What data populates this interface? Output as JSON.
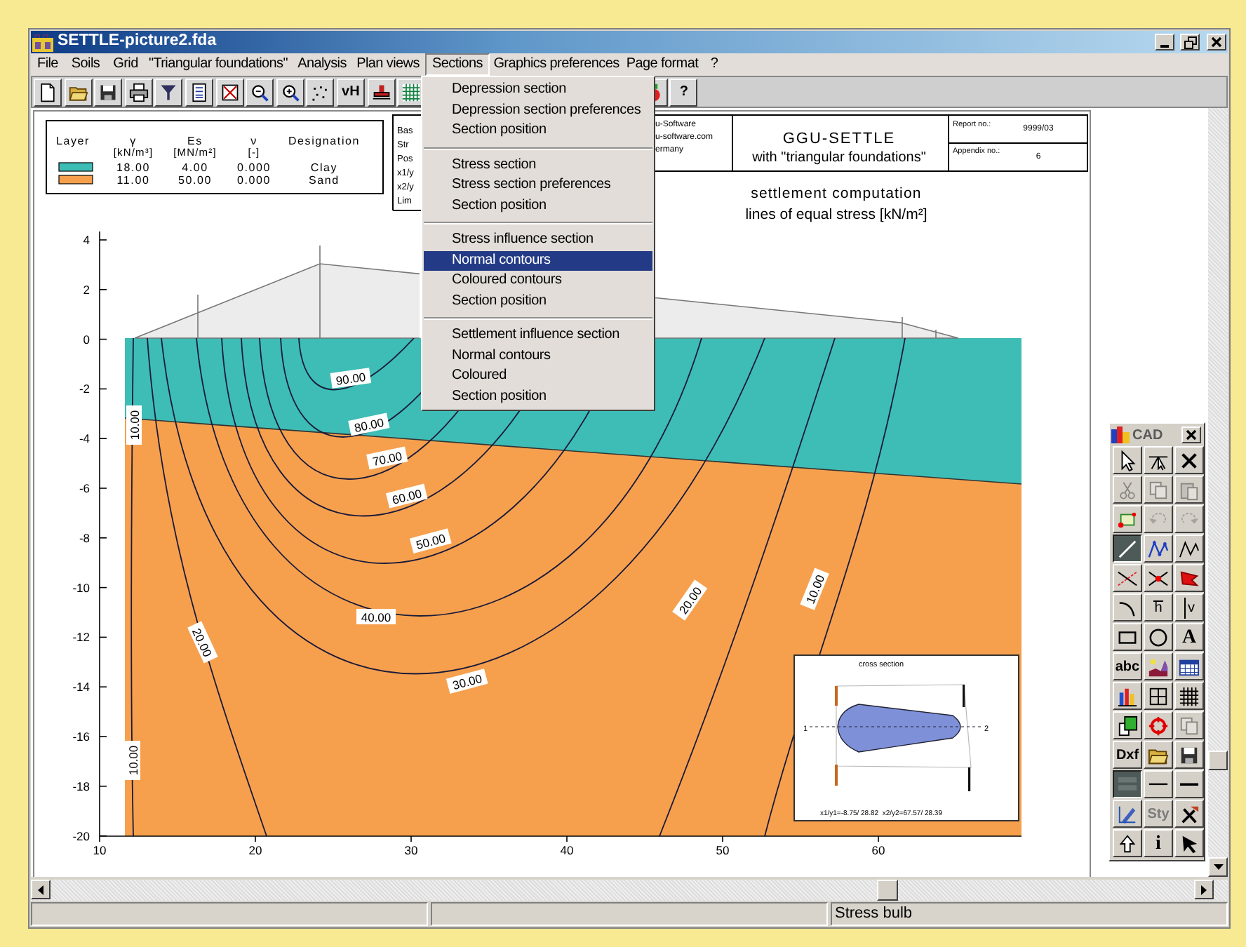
{
  "window": {
    "title": "SETTLE-picture2.fda"
  },
  "menu_bar": [
    {
      "label": "File",
      "selected": false
    },
    {
      "label": "Soils",
      "selected": false
    },
    {
      "label": "Grid",
      "selected": false
    },
    {
      "label": "\"Triangular foundations\"",
      "selected": false
    },
    {
      "label": "Analysis",
      "selected": false
    },
    {
      "label": "Plan views",
      "selected": false
    },
    {
      "label": "Sections",
      "selected": true
    },
    {
      "label": "Graphics preferences",
      "selected": false
    },
    {
      "label": "Page format",
      "selected": false
    },
    {
      "label": "?",
      "selected": false
    }
  ],
  "toolbar": [
    {
      "label": "vH"
    },
    {
      "label": "?"
    }
  ],
  "sections_menu": {
    "items": [
      {
        "kind": "item",
        "label": "Depression section",
        "selected": false
      },
      {
        "kind": "item",
        "label": "Depression section preferences",
        "selected": false
      },
      {
        "kind": "item",
        "label": "Section position",
        "selected": false
      },
      {
        "kind": "separator"
      },
      {
        "kind": "item",
        "label": "Stress section",
        "selected": false
      },
      {
        "kind": "item",
        "label": "Stress section preferences",
        "selected": false
      },
      {
        "kind": "item",
        "label": "Section position",
        "selected": false
      },
      {
        "kind": "separator"
      },
      {
        "kind": "item",
        "label": "Stress influence section",
        "selected": false
      },
      {
        "kind": "item",
        "label": "Normal contours",
        "selected": true
      },
      {
        "kind": "item",
        "label": "Coloured contours",
        "selected": false
      },
      {
        "kind": "item",
        "label": "Section position",
        "selected": false
      },
      {
        "kind": "separator"
      },
      {
        "kind": "item",
        "label": "Settlement influence section",
        "selected": false
      },
      {
        "kind": "item",
        "label": "Normal contours",
        "selected": false
      },
      {
        "kind": "item",
        "label": "Coloured",
        "selected": false
      },
      {
        "kind": "item",
        "label": "Section position",
        "selected": false
      }
    ]
  },
  "legend": {
    "columns": [
      {
        "symbol": "Layer"
      },
      {
        "symbol": "γ",
        "unit": "[kN/m³]"
      },
      {
        "symbol": "Es",
        "unit": "[MN/m²]"
      },
      {
        "symbol": "ν",
        "unit": "[-]"
      },
      {
        "symbol": "Designation"
      }
    ],
    "rows": [
      {
        "color": "#3dbdb5",
        "gamma": "18.00",
        "es": "4.00",
        "nu": "0.000",
        "designation": "Clay"
      },
      {
        "color": "#f6a04e",
        "gamma": "11.00",
        "es": "50.00",
        "nu": "0.000",
        "designation": "Sand"
      }
    ]
  },
  "header": {
    "cut_lines": [
      "Bas",
      "Str",
      "Pos",
      "x1/y",
      "x2/y",
      "Lim"
    ],
    "company_lines": [
      "u-Software",
      "u-software.com",
      "ermany"
    ],
    "program": "GGU-SETTLE",
    "subtitle": "with \"triangular foundations\"",
    "report_label": "Report no.:",
    "report_no": "9999/03",
    "appendix_label": "Appendix no.:",
    "appendix_no": "6"
  },
  "plot": {
    "title_lines": [
      "settlement computation",
      "lines of equal stress [kN/m²]"
    ],
    "y_ticks": [
      "4",
      "2",
      "0",
      "-2",
      "-4",
      "-6",
      "-8",
      "-10",
      "-12",
      "-14",
      "-16",
      "-18",
      "-20"
    ],
    "x_ticks": [
      "10",
      "20",
      "30",
      "40",
      "50",
      "60"
    ],
    "contour_labels": [
      "90.00",
      "80.00",
      "70.00",
      "60.00",
      "50.00",
      "40.00",
      "30.00",
      "20.00",
      "10.00",
      "10.00",
      "20.00",
      "10.00"
    ]
  },
  "inset": {
    "title": "cross section",
    "point_labels": [
      "1",
      "2"
    ],
    "footer": "x1/y1=-8.75/ 28.82  x2/y2=67.57/ 28.39"
  },
  "cad_palette": {
    "title": "CAD",
    "tools": [
      {
        "disabled": false,
        "pressed": false
      },
      {
        "disabled": false,
        "pressed": false
      },
      {
        "disabled": false,
        "pressed": false
      },
      {
        "disabled": true,
        "pressed": false
      },
      {
        "disabled": true,
        "pressed": false
      },
      {
        "disabled": true,
        "pressed": false
      },
      {
        "disabled": false,
        "pressed": false
      },
      {
        "disabled": true,
        "pressed": false
      },
      {
        "disabled": true,
        "pressed": false
      },
      {
        "disabled": false,
        "pressed": true
      },
      {
        "disabled": false,
        "pressed": false
      },
      {
        "disabled": false,
        "pressed": false
      },
      {
        "disabled": false,
        "pressed": false
      },
      {
        "disabled": false,
        "pressed": false
      },
      {
        "disabled": false,
        "pressed": false
      },
      {
        "disabled": false,
        "pressed": false
      },
      {
        "label": "h",
        "disabled": false,
        "pressed": false
      },
      {
        "label": "v",
        "disabled": false,
        "pressed": false
      },
      {
        "disabled": false,
        "pressed": false
      },
      {
        "disabled": false,
        "pressed": false
      },
      {
        "label": "A",
        "disabled": false,
        "pressed": false
      },
      {
        "label": "abc",
        "disabled": false,
        "pressed": false
      },
      {
        "disabled": false,
        "pressed": false
      },
      {
        "disabled": false,
        "pressed": false
      },
      {
        "disabled": false,
        "pressed": false
      },
      {
        "disabled": false,
        "pressed": false
      },
      {
        "disabled": false,
        "pressed": false
      },
      {
        "disabled": false,
        "pressed": false
      },
      {
        "disabled": false,
        "pressed": false
      },
      {
        "disabled": true,
        "pressed": false
      },
      {
        "label": "Dxf",
        "disabled": false,
        "pressed": false
      },
      {
        "disabled": false,
        "pressed": false
      },
      {
        "disabled": false,
        "pressed": false
      },
      {
        "disabled": false,
        "pressed": true
      },
      {
        "disabled": false,
        "pressed": false
      },
      {
        "disabled": false,
        "pressed": false
      },
      {
        "disabled": false,
        "pressed": false
      },
      {
        "label": "Sty",
        "disabled": true,
        "pressed": false
      },
      {
        "disabled": false,
        "pressed": false
      },
      {
        "disabled": false,
        "pressed": false
      },
      {
        "label": "i",
        "disabled": false,
        "pressed": false
      },
      {
        "disabled": false,
        "pressed": false
      }
    ]
  },
  "status_bar": {
    "text": "Stress bulb"
  }
}
